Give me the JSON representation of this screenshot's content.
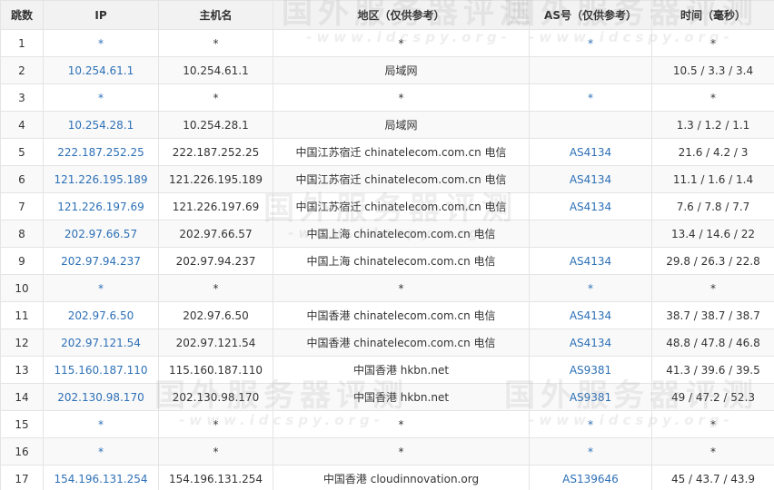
{
  "headers": [
    "跳数",
    "IP",
    "主机名",
    "地区（仅供参考）",
    "AS号（仅供参考）",
    "时间（毫秒）"
  ],
  "rows": [
    {
      "hop": "1",
      "ip": "*",
      "host": "*",
      "region": "*",
      "asn": "*",
      "time": "*"
    },
    {
      "hop": "2",
      "ip": "10.254.61.1",
      "host": "10.254.61.1",
      "region": "局域网",
      "asn": "",
      "time": "10.5 / 3.3 / 3.4"
    },
    {
      "hop": "3",
      "ip": "*",
      "host": "*",
      "region": "*",
      "asn": "*",
      "time": "*"
    },
    {
      "hop": "4",
      "ip": "10.254.28.1",
      "host": "10.254.28.1",
      "region": "局域网",
      "asn": "",
      "time": "1.3 / 1.2 / 1.1"
    },
    {
      "hop": "5",
      "ip": "222.187.252.25",
      "host": "222.187.252.25",
      "region": "中国江苏宿迁 chinatelecom.com.cn 电信",
      "asn": "AS4134",
      "time": "21.6 / 4.2 / 3"
    },
    {
      "hop": "6",
      "ip": "121.226.195.189",
      "host": "121.226.195.189",
      "region": "中国江苏宿迁 chinatelecom.com.cn 电信",
      "asn": "AS4134",
      "time": "11.1 / 1.6 / 1.4"
    },
    {
      "hop": "7",
      "ip": "121.226.197.69",
      "host": "121.226.197.69",
      "region": "中国江苏宿迁 chinatelecom.com.cn 电信",
      "asn": "AS4134",
      "time": "7.6 / 7.8 / 7.7"
    },
    {
      "hop": "8",
      "ip": "202.97.66.57",
      "host": "202.97.66.57",
      "region": "中国上海 chinatelecom.com.cn 电信",
      "asn": "",
      "time": "13.4 / 14.6 / 22"
    },
    {
      "hop": "9",
      "ip": "202.97.94.237",
      "host": "202.97.94.237",
      "region": "中国上海 chinatelecom.com.cn 电信",
      "asn": "AS4134",
      "time": "29.8 / 26.3 / 22.8"
    },
    {
      "hop": "10",
      "ip": "*",
      "host": "*",
      "region": "*",
      "asn": "*",
      "time": "*"
    },
    {
      "hop": "11",
      "ip": "202.97.6.50",
      "host": "202.97.6.50",
      "region": "中国香港 chinatelecom.com.cn 电信",
      "asn": "AS4134",
      "time": "38.7 / 38.7 / 38.7"
    },
    {
      "hop": "12",
      "ip": "202.97.121.54",
      "host": "202.97.121.54",
      "region": "中国香港 chinatelecom.com.cn 电信",
      "asn": "AS4134",
      "time": "48.8 / 47.8 / 46.8"
    },
    {
      "hop": "13",
      "ip": "115.160.187.110",
      "host": "115.160.187.110",
      "region": "中国香港 hkbn.net",
      "asn": "AS9381",
      "time": "41.3 / 39.6 / 39.5"
    },
    {
      "hop": "14",
      "ip": "202.130.98.170",
      "host": "202.130.98.170",
      "region": "中国香港 hkbn.net",
      "asn": "AS9381",
      "time": "49 / 47.2 / 52.3"
    },
    {
      "hop": "15",
      "ip": "*",
      "host": "*",
      "region": "*",
      "asn": "*",
      "time": "*"
    },
    {
      "hop": "16",
      "ip": "*",
      "host": "*",
      "region": "*",
      "asn": "*",
      "time": "*"
    },
    {
      "hop": "17",
      "ip": "154.196.131.254",
      "host": "154.196.131.254",
      "region": "中国香港 cloudinnovation.org",
      "asn": "AS139646",
      "time": "45 / 43.7 / 43.9"
    }
  ],
  "watermark": {
    "title": "国外服务器评测",
    "url": "-www.idcspy.org-"
  },
  "colors": {
    "link": "#2d70b7",
    "header_bg": "#f2f2f2",
    "border": "#e4e4e4",
    "stripe": "#f9f9f9"
  }
}
